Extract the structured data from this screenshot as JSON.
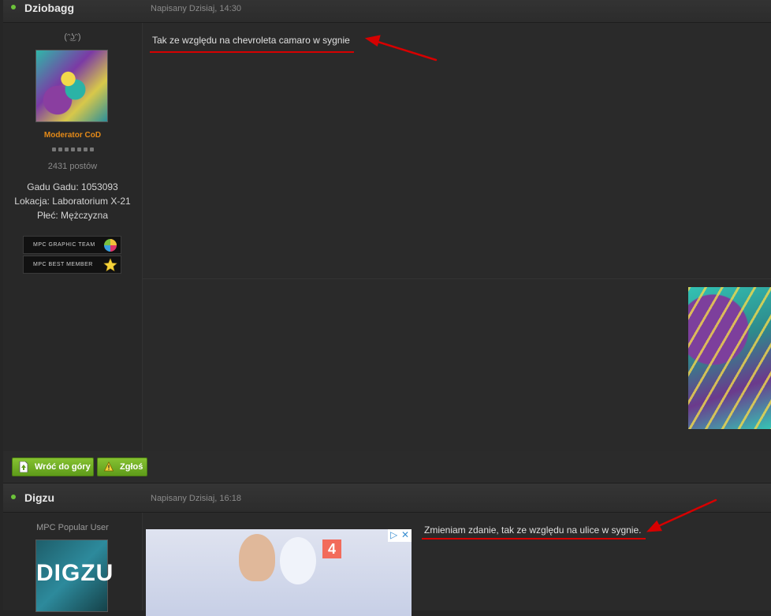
{
  "post1": {
    "author": "Dziobagg",
    "date": "Napisany Dzisiaj, 14:30",
    "smiley": "(ᵔ͜ʖᵔ)",
    "rank": "Moderator CoD",
    "post_count": "2431 postów",
    "info": [
      "Gadu Gadu: 1053093",
      "Lokacja: Laboratorium X-21",
      "Płeć: Mężczyzna"
    ],
    "badges": [
      "MPC GRAPHIC TEAM",
      "MPC BEST MEMBER"
    ],
    "text": "Tak ze względu na chevroleta camaro w sygnie"
  },
  "buttons": {
    "back_to_top": "Wróć do góry",
    "report": "Zgłoś"
  },
  "post2": {
    "author": "Digzu",
    "date": "Napisany Dzisiaj, 16:18",
    "rank": "MPC Popular User",
    "avatar_text": "DIGZU",
    "text": "Zmieniam zdanie, tak ze względu na ulice w sygnie.",
    "ad_badge": "4"
  },
  "colors": {
    "online": "#6cc33a",
    "rank": "#e48a18",
    "annotation": "#d60000",
    "button": "#7ab52a"
  }
}
